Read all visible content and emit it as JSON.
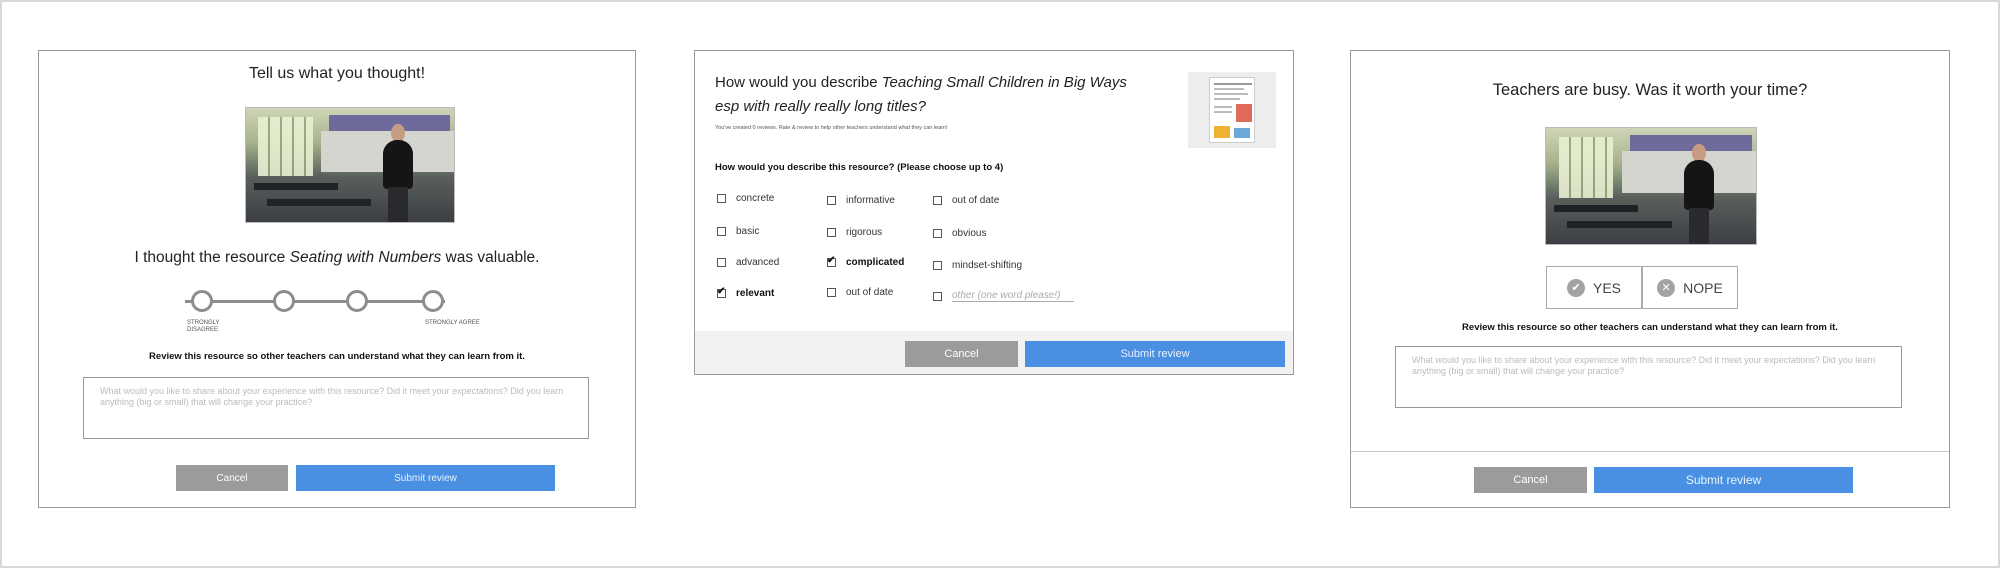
{
  "panel1": {
    "title": "Tell us what you thought!",
    "statement_prefix": "I thought the resource ",
    "statement_resource": "Seating with Numbers",
    "statement_suffix": " was valuable.",
    "scale_left_label": "STRONGLY DISAGREE",
    "scale_right_label": "STRONGLY AGREE",
    "review_prompt": "Review this resource so other teachers can understand what they can learn from it.",
    "review_placeholder": "What would you like to share about your experience with this resource? Did it meet your expectations? Did you learn anything (big or small) that will change your practice?",
    "cancel_label": "Cancel",
    "submit_label": "Submit review"
  },
  "panel2": {
    "title_prefix": "How would you describe ",
    "title_resource": "Teaching Small Children in Big Ways esp with really really long titles?",
    "subtitle": "You've created 0 reviews.  Rate & review to help other teachers understand what they can learn!",
    "question": "How would you describe this resource? (Please choose up to 4)",
    "options": [
      {
        "label": "concrete",
        "checked": false
      },
      {
        "label": "informative",
        "checked": false
      },
      {
        "label": "out of date",
        "checked": false
      },
      {
        "label": "basic",
        "checked": false
      },
      {
        "label": "rigorous",
        "checked": false
      },
      {
        "label": "obvious",
        "checked": false
      },
      {
        "label": "advanced",
        "checked": false
      },
      {
        "label": "complicated",
        "checked": true
      },
      {
        "label": "mindset-shifting",
        "checked": false
      },
      {
        "label": "relevant",
        "checked": true
      },
      {
        "label": "out of date",
        "checked": false
      }
    ],
    "other_placeholder": "other (one word please!)",
    "cancel_label": "Cancel",
    "submit_label": "Submit review"
  },
  "panel3": {
    "title": "Teachers are busy. Was it worth your time?",
    "yes_label": "YES",
    "nope_label": "NOPE",
    "review_prompt": "Review this resource so other teachers can understand what they can learn from it.",
    "review_placeholder": "What would you like to share about your experience with this resource? Did it meet your expectations? Did you learn anything (big or small) that will change your practice?",
    "cancel_label": "Cancel",
    "submit_label": "Submit review"
  },
  "colors": {
    "accent": "#4a90e2",
    "cancel_gray": "#9b9b9b",
    "scale_gray": "#8d8d8d"
  }
}
